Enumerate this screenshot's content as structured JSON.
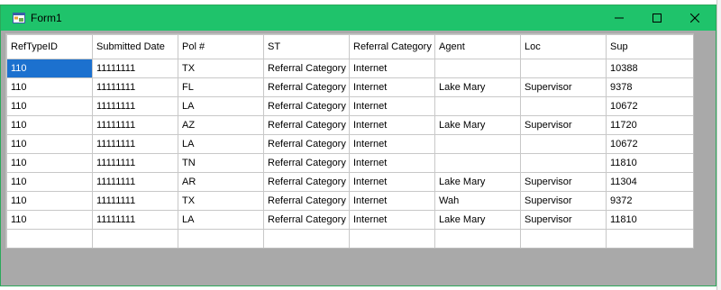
{
  "window": {
    "title": "Form1"
  },
  "grid": {
    "columns": [
      {
        "label": "RefTypeID"
      },
      {
        "label": "Submitted Date"
      },
      {
        "label": "Pol #"
      },
      {
        "label": "ST"
      },
      {
        "label": "Referral Category"
      },
      {
        "label": "Agent"
      },
      {
        "label": "Loc"
      },
      {
        "label": "Sup"
      }
    ],
    "rows": [
      [
        "110",
        "11111111",
        "TX",
        "Referral Category",
        "Internet",
        "",
        "",
        "10388"
      ],
      [
        "110",
        "11111111",
        "FL",
        "Referral Category",
        "Internet",
        "Lake Mary",
        "Supervisor",
        "9378"
      ],
      [
        "110",
        "11111111",
        "LA",
        "Referral Category",
        "Internet",
        "",
        "",
        "10672"
      ],
      [
        "110",
        "11111111",
        "AZ",
        "Referral Category",
        "Internet",
        "Lake Mary",
        "Supervisor",
        "11720"
      ],
      [
        "110",
        "11111111",
        "LA",
        "Referral Category",
        "Internet",
        "",
        "",
        "10672"
      ],
      [
        "110",
        "11111111",
        "TN",
        "Referral Category",
        "Internet",
        "",
        "",
        "11810"
      ],
      [
        "110",
        "11111111",
        "AR",
        "Referral Category",
        "Internet",
        "Lake Mary",
        "Supervisor",
        "11304"
      ],
      [
        "110",
        "11111111",
        "TX",
        "Referral Category",
        "Internet",
        "Wah",
        "Supervisor",
        "9372"
      ],
      [
        "110",
        "11111111",
        "LA",
        "Referral Category",
        "Internet",
        "Lake Mary",
        "Supervisor",
        "11810"
      ]
    ]
  },
  "colors": {
    "titlebar": "#1fc36b",
    "selection": "#1c71cf",
    "client_bg": "#a9a9a9"
  }
}
